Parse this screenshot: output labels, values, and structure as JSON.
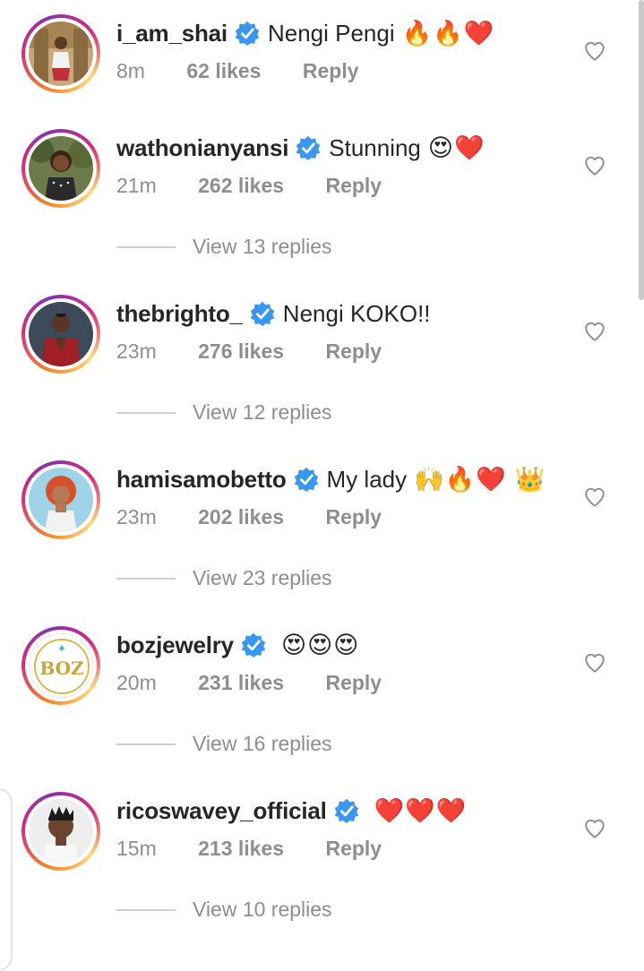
{
  "comments": [
    {
      "username": "i_am_shai",
      "text": "Nengi Pengi",
      "emojis": "🔥🔥❤️",
      "time": "8m",
      "likes": "62 likes",
      "reply": "Reply",
      "view_replies": ""
    },
    {
      "username": "wathonianyansi",
      "text": "Stunning",
      "emojis": "😍❤️",
      "time": "21m",
      "likes": "262 likes",
      "reply": "Reply",
      "view_replies": "View 13 replies"
    },
    {
      "username": "thebrighto_",
      "text": "Nengi KOKO!!",
      "emojis": "",
      "time": "23m",
      "likes": "276 likes",
      "reply": "Reply",
      "view_replies": "View 12 replies"
    },
    {
      "username": "hamisamobetto",
      "text": "My lady",
      "emojis": "🙌🔥❤️ 👑",
      "time": "23m",
      "likes": "202 likes",
      "reply": "Reply",
      "view_replies": "View 23 replies"
    },
    {
      "username": "bozjewelry",
      "text": "",
      "emojis": "😍😍😍",
      "time": "20m",
      "likes": "231 likes",
      "reply": "Reply",
      "view_replies": "View 16 replies",
      "avatar_logo": "BOZ"
    },
    {
      "username": "ricoswavey_official",
      "text": "",
      "emojis": "❤️❤️❤️",
      "time": "15m",
      "likes": "213 likes",
      "reply": "Reply",
      "view_replies": "View 10 replies"
    }
  ],
  "icons": {
    "verified": "verified-badge-icon",
    "like": "heart-outline-icon"
  },
  "colors": {
    "verified": "#3897f0",
    "meta": "#8e8e8e",
    "text": "#262626"
  }
}
